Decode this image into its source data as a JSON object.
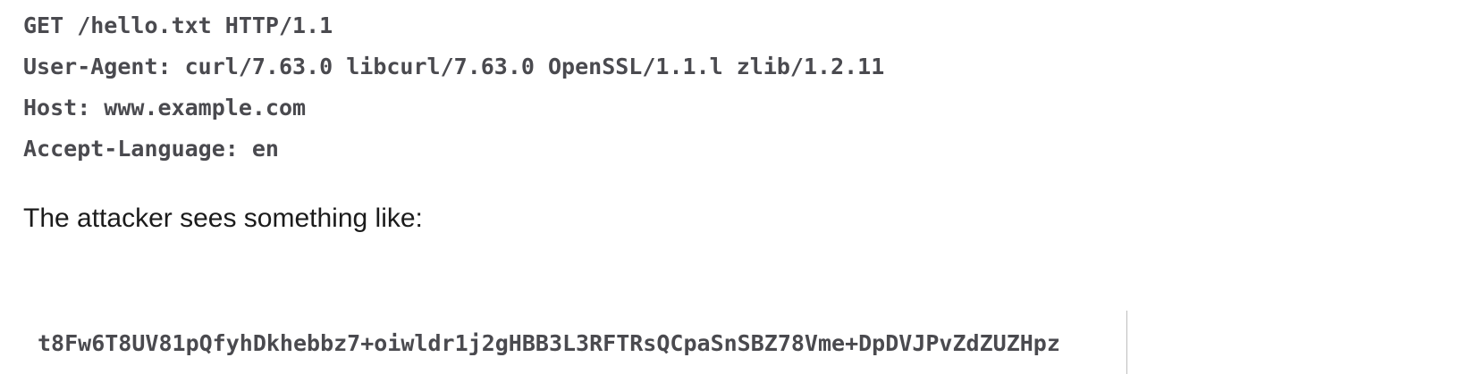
{
  "request": {
    "lines": [
      "GET /hello.txt HTTP/1.1",
      "User-Agent: curl/7.63.0 libcurl/7.63.0 OpenSSL/1.1.l zlib/1.2.11",
      "Host: www.example.com",
      "Accept-Language: en"
    ]
  },
  "prose": {
    "text": "The attacker sees something like:"
  },
  "cipher": {
    "text": "t8Fw6T8UV81pQfyhDkhebbz7+oiwldr1j2gHBB3L3RFTRsQCpaSnSBZ78Vme+DpDVJPvZdZUZHpz"
  }
}
